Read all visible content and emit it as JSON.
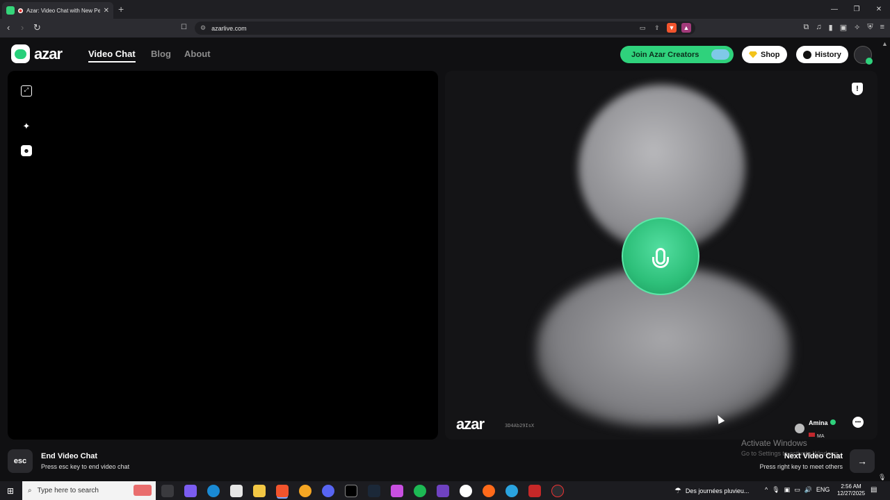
{
  "browser": {
    "tab_title": "Azar: Video Chat with New Pe",
    "new_tab": "+",
    "url": "azarlive.com",
    "window_controls": [
      "—",
      "❐",
      "✕"
    ]
  },
  "header": {
    "logo_text": "azar",
    "nav": [
      {
        "label": "Video Chat",
        "active": true
      },
      {
        "label": "Blog",
        "active": false
      },
      {
        "label": "About",
        "active": false
      }
    ],
    "join_label": "Join Azar Creators",
    "shop_label": "Shop",
    "history_label": "History"
  },
  "remote": {
    "watermark": "azar",
    "session_id": "3D4Ab29IsX",
    "peer_name": "Amina",
    "peer_country": "MA"
  },
  "controls": {
    "esc_key": "esc",
    "end_title": "End Video Chat",
    "end_sub": "Press esc key to end video chat",
    "next_title": "Next Video Chat",
    "next_sub": "Press right key to meet others",
    "next_key": "→"
  },
  "watermark_os": {
    "title": "Activate Windows",
    "sub": "Go to Settings to activate Windows."
  },
  "taskbar": {
    "search_placeholder": "Type here to search",
    "weather": "Des journées pluvieu...",
    "lang": "ENG",
    "time": "2:56 AM",
    "date": "12/27/2025"
  },
  "colors": {
    "accent": "#2fd27c",
    "brand": "#27d07a",
    "background": "#101012"
  }
}
